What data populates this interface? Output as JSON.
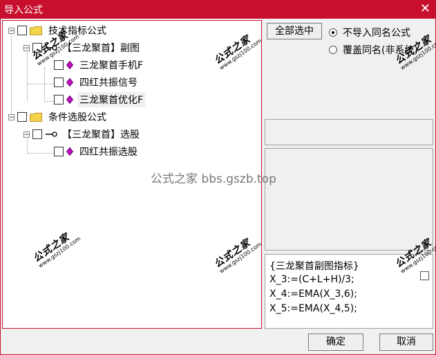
{
  "window": {
    "title": "导入公式",
    "close_glyph": "✕"
  },
  "tree": {
    "group1": {
      "expander": "−",
      "label": "技术指标公式"
    },
    "formula1": {
      "expander": "−",
      "label": "【三龙聚首】副图"
    },
    "items1": [
      "三龙聚首手机F",
      "四红共振信号",
      "三龙聚首优化F"
    ],
    "group2": {
      "expander": "−",
      "label": "条件选股公式"
    },
    "formula2": {
      "expander": "−",
      "label": "【三龙聚首】选股"
    },
    "items2": [
      "四红共振选股"
    ]
  },
  "buttons": {
    "select_all": "全部选中",
    "ok": "确定",
    "cancel": "取消"
  },
  "options": {
    "no_import": "不导入同名公式",
    "overwrite": "覆盖同名(非系统)",
    "selected": "no_import"
  },
  "code": {
    "lines": [
      "{三龙聚首副图指标}",
      "X_3:=(C+L+H)/3;",
      "X_4:=EMA(X_3,6);",
      "X_5:=EMA(X_4,5);"
    ]
  },
  "watermarks": {
    "brand": "公式之家",
    "site": "www.gszj100.com",
    "center": "公式之家 bbs.gszb.top"
  },
  "colors": {
    "titlebar": "#c8102e",
    "folder": "#f5d34a",
    "diamond": "#c010c0"
  }
}
